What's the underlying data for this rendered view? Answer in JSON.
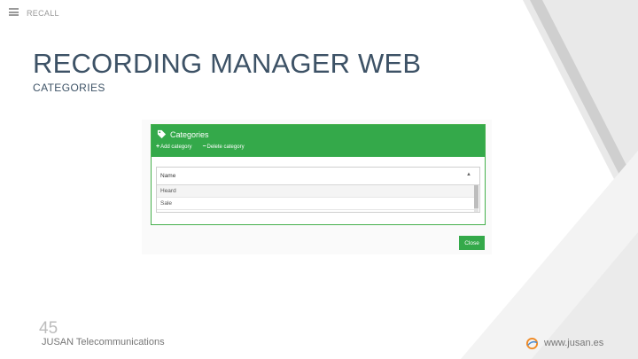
{
  "slide": {
    "brand_small": "RECALL",
    "title": "RECORDING MANAGER WEB",
    "subtitle": "CATEGORIES",
    "page_number": "45",
    "company": "JUSAN Telecommunications",
    "website": "www.jusan.es"
  },
  "dialog": {
    "title": "Categories",
    "add_label": "Add category",
    "delete_label": "Delete category",
    "add_symbol": "+",
    "delete_symbol": "−",
    "column_header": "Name",
    "sort_symbol": "▲",
    "rows": [
      "Heard",
      "Sale"
    ],
    "close_label": "Close"
  },
  "colors": {
    "header_green": "#34a94a",
    "title_blue": "#3d5266",
    "deco_gray": "#e9e9e9"
  },
  "icons": [
    "menu-icon",
    "tag-icon",
    "plus-icon",
    "minus-icon",
    "sort-up-icon",
    "jusan-logo-icon"
  ]
}
